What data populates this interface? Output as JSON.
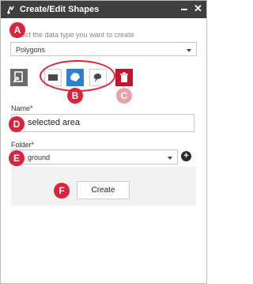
{
  "window": {
    "title": "Create/Edit Shapes",
    "minimize_icon": "minimize-icon",
    "close_label": "✕",
    "title_icon": "shapes-icon"
  },
  "data_type": {
    "instruction": "Select the data type you want to create",
    "selected": "Polygons"
  },
  "tools": [
    {
      "name": "import-shapes-icon"
    },
    {
      "name": "rectangle-tool-icon"
    },
    {
      "name": "polygon-tool-icon"
    },
    {
      "name": "freehand-tool-icon"
    },
    {
      "name": "delete-tool-icon"
    }
  ],
  "name_field": {
    "label": "Name*",
    "value": "selected area"
  },
  "folder_field": {
    "label": "Folder*",
    "value": "ground"
  },
  "create_button": {
    "label": "Create"
  },
  "annotations": {
    "a": "A",
    "b": "B",
    "c": "C",
    "d": "D",
    "e": "E",
    "f": "F"
  },
  "colors": {
    "titlebar": "#3f3f3f",
    "marker": "#d8243c",
    "marker_faded": "#e7a3a9",
    "tool_active": "#2e7fd0",
    "tool_delete": "#c0152f"
  }
}
